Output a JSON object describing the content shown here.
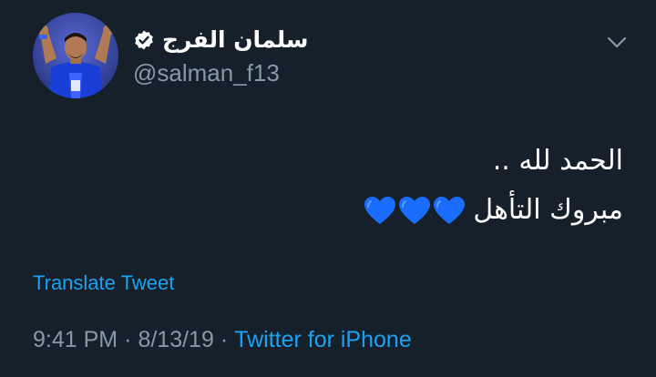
{
  "author": {
    "display_name": "سلمان الفرج",
    "handle": "@salman_f13",
    "verified_icon": "verified-badge-icon",
    "avatar": "profile-avatar"
  },
  "menu": {
    "caret_icon": "chevron-down-icon"
  },
  "tweet": {
    "line1": "الحمد لله ..",
    "line2": "مبروك التأهل",
    "heart_emoji_count": 3,
    "heart_icon": "blue-heart-icon",
    "heart_color": "#1a6dff"
  },
  "translate": {
    "label": "Translate Tweet"
  },
  "meta": {
    "time": "9:41 PM",
    "separator": "·",
    "date": "8/13/19",
    "source": "Twitter for iPhone"
  },
  "colors": {
    "background": "#15202b",
    "primary_text": "#ffffff",
    "secondary_text": "#8899a6",
    "accent": "#1da1f2"
  }
}
